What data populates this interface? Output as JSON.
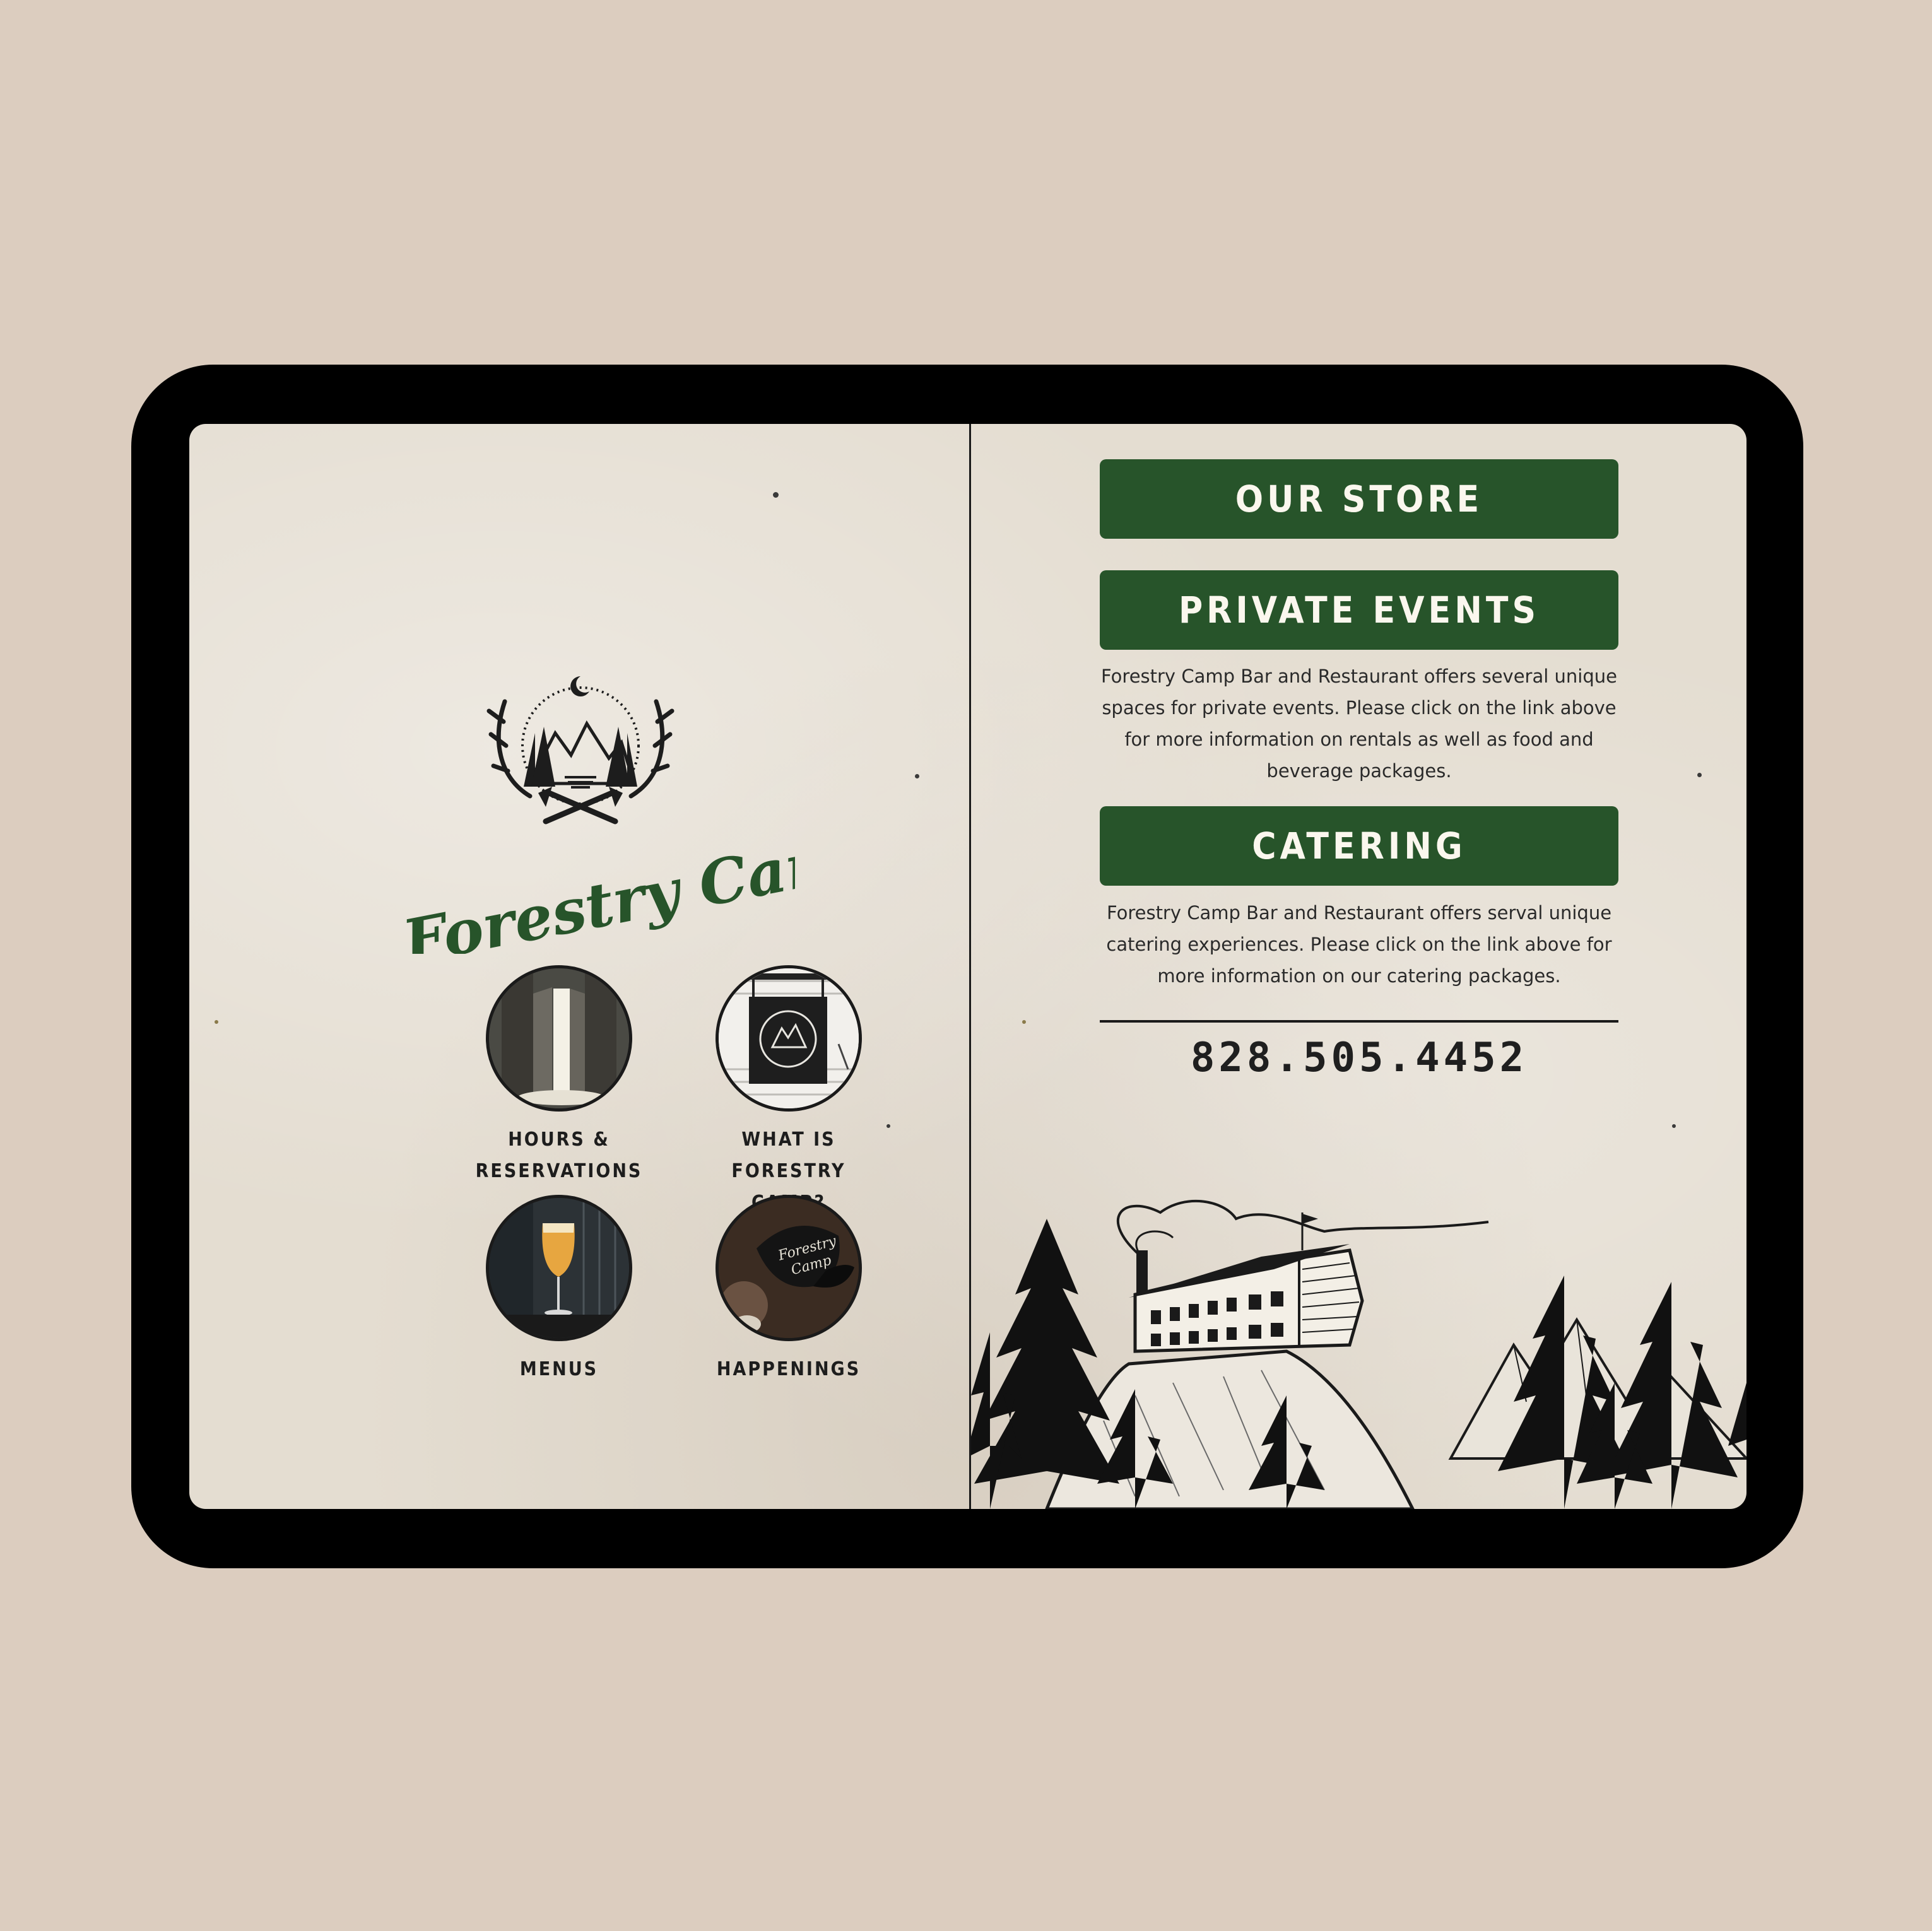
{
  "left": {
    "brand_name": "Forestry Camp",
    "crest_icon": "antler-mountain-crest-icon",
    "nav_items": [
      {
        "label_line1": "HOURS &",
        "label_line2": "RESERVATIONS",
        "image": "open-door-photo"
      },
      {
        "label_line1": "WHAT IS",
        "label_line2": "FORESTRY CAMP?",
        "image": "hanging-sign-photo"
      },
      {
        "label_line1": "MENUS",
        "label_line2": "",
        "image": "beer-glass-photo"
      },
      {
        "label_line1": "HAPPENINGS",
        "label_line2": "",
        "image": "cap-photo"
      }
    ]
  },
  "right": {
    "store_button": "OUR STORE",
    "events_button": "PRIVATE EVENTS",
    "events_text": "Forestry Camp Bar and Restaurant offers several unique spaces for private events. Please click on the link above for more information on rentals as well as food and beverage packages.",
    "catering_button": "CATERING",
    "catering_text": "Forestry Camp Bar and Restaurant offers serval unique catering experiences. Please click on the link above for more information on our catering packages.",
    "phone": "828.505.4452",
    "scene_illustration": "hilltop-lodge-forest-illustration"
  },
  "colors": {
    "background": "#dccdbf",
    "frame": "#000000",
    "paper": "#e4ddd1",
    "brand_green": "#27542a",
    "ink": "#1d1d1d"
  }
}
